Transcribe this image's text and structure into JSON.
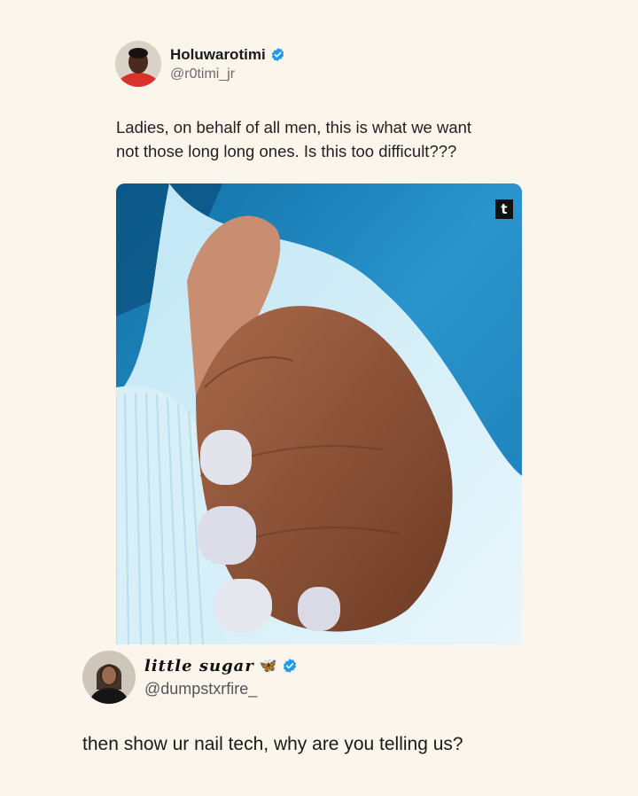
{
  "tweet1": {
    "display_name": "Holuwarotimi",
    "handle": "@r0timi_jr",
    "verified": true,
    "avatar_icon": "profile-photo",
    "text_lines": [
      "Ladies, on behalf of all men, this is what we want",
      "not those long long ones. Is this too difficult???"
    ],
    "photo": {
      "subject": "hand-with-short-nails-photo",
      "badge": "t"
    }
  },
  "tweet2": {
    "display_name": "little sugar",
    "name_emoji": "🦋",
    "handle": "@dumpstxrfire_",
    "verified": true,
    "avatar_icon": "profile-photo",
    "text": "then show ur nail tech, why are you telling us?"
  },
  "colors": {
    "background": "#fbf5ec",
    "verified_blue": "#1d9bf0",
    "handle_gray": "#6b6b6b"
  }
}
